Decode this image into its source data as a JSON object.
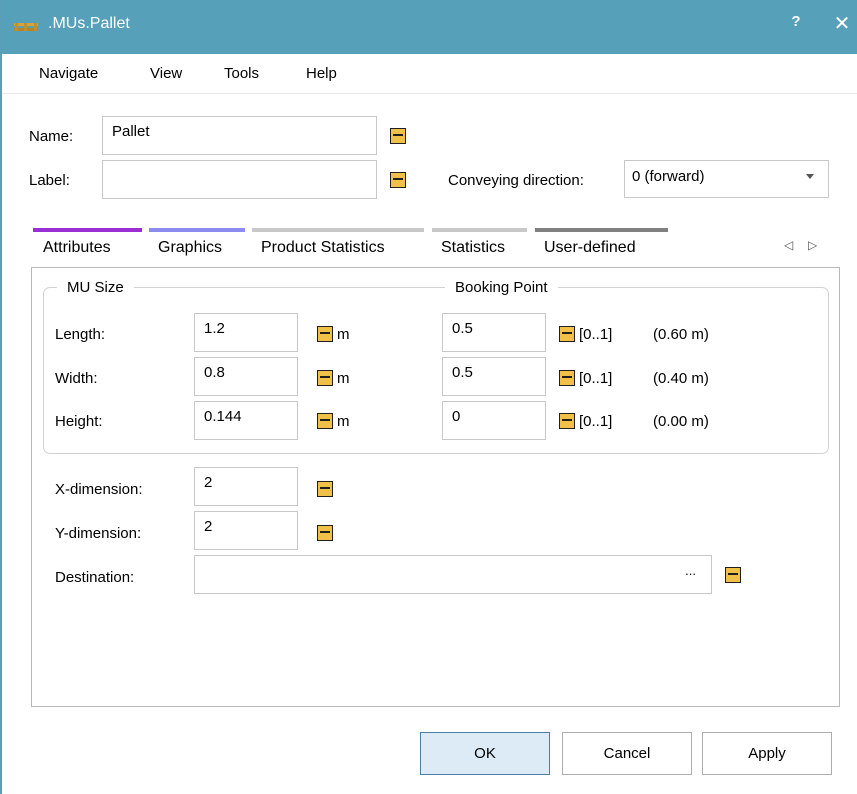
{
  "window": {
    "title": ".MUs.Pallet",
    "help_glyph": "?",
    "close_glyph": "✕"
  },
  "menu": [
    "Navigate",
    "View",
    "Tools",
    "Help"
  ],
  "header": {
    "name_label": "Name:",
    "name_value": "Pallet",
    "label_label": "Label:",
    "label_value": "",
    "conveying_label": "Conveying direction:",
    "conveying_value": "0 (forward)"
  },
  "tabs": [
    {
      "label": "Attributes",
      "bar_color": "#9b2fd6",
      "active": true
    },
    {
      "label": "Graphics",
      "bar_color": "#8c8cf0",
      "active": false
    },
    {
      "label": "Product Statistics",
      "bar_color": "#c8c8c8",
      "active": false
    },
    {
      "label": "Statistics",
      "bar_color": "#c8c8c8",
      "active": false
    },
    {
      "label": "User-defined",
      "bar_color": "#808080",
      "active": false
    }
  ],
  "tab_scroll": {
    "left": "◁",
    "right": "▷"
  },
  "attributes": {
    "mu_size_title": "MU Size",
    "booking_point_title": "Booking Point",
    "rows": [
      {
        "label": "Length:",
        "value": "1.2",
        "unit": "m",
        "bp_value": "0.5",
        "bp_range": "[0..1]",
        "bp_abs": "(0.60 m)"
      },
      {
        "label": "Width:",
        "value": "0.8",
        "unit": "m",
        "bp_value": "0.5",
        "bp_range": "[0..1]",
        "bp_abs": "(0.40 m)"
      },
      {
        "label": "Height:",
        "value": "0.144",
        "unit": "m",
        "bp_value": "0",
        "bp_range": "[0..1]",
        "bp_abs": "(0.00 m)"
      }
    ],
    "x_dimension_label": "X-dimension:",
    "x_dimension_value": "2",
    "y_dimension_label": "Y-dimension:",
    "y_dimension_value": "2",
    "destination_label": "Destination:",
    "destination_value": "",
    "destination_browse": "..."
  },
  "buttons": {
    "ok": "OK",
    "cancel": "Cancel",
    "apply": "Apply"
  },
  "colors": {
    "titlebar": "#57a0b9",
    "inherit_icon": "#f0c048",
    "ok_button": "#dcebf5"
  }
}
